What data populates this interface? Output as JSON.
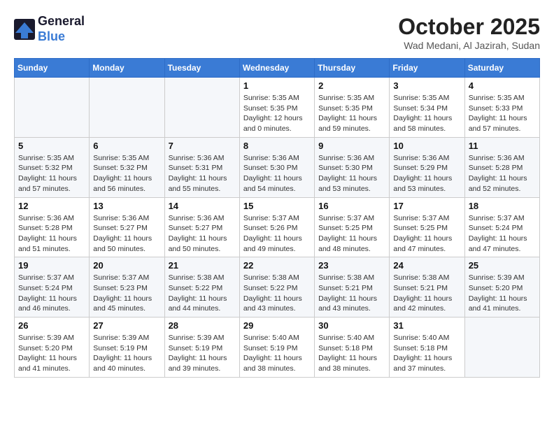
{
  "header": {
    "logo_line1": "General",
    "logo_line2": "Blue",
    "month_title": "October 2025",
    "subtitle": "Wad Medani, Al Jazirah, Sudan"
  },
  "weekdays": [
    "Sunday",
    "Monday",
    "Tuesday",
    "Wednesday",
    "Thursday",
    "Friday",
    "Saturday"
  ],
  "weeks": [
    [
      {
        "day": "",
        "info": ""
      },
      {
        "day": "",
        "info": ""
      },
      {
        "day": "",
        "info": ""
      },
      {
        "day": "1",
        "info": "Sunrise: 5:35 AM\nSunset: 5:35 PM\nDaylight: 12 hours and 0 minutes."
      },
      {
        "day": "2",
        "info": "Sunrise: 5:35 AM\nSunset: 5:35 PM\nDaylight: 11 hours and 59 minutes."
      },
      {
        "day": "3",
        "info": "Sunrise: 5:35 AM\nSunset: 5:34 PM\nDaylight: 11 hours and 58 minutes."
      },
      {
        "day": "4",
        "info": "Sunrise: 5:35 AM\nSunset: 5:33 PM\nDaylight: 11 hours and 57 minutes."
      }
    ],
    [
      {
        "day": "5",
        "info": "Sunrise: 5:35 AM\nSunset: 5:32 PM\nDaylight: 11 hours and 57 minutes."
      },
      {
        "day": "6",
        "info": "Sunrise: 5:35 AM\nSunset: 5:32 PM\nDaylight: 11 hours and 56 minutes."
      },
      {
        "day": "7",
        "info": "Sunrise: 5:36 AM\nSunset: 5:31 PM\nDaylight: 11 hours and 55 minutes."
      },
      {
        "day": "8",
        "info": "Sunrise: 5:36 AM\nSunset: 5:30 PM\nDaylight: 11 hours and 54 minutes."
      },
      {
        "day": "9",
        "info": "Sunrise: 5:36 AM\nSunset: 5:30 PM\nDaylight: 11 hours and 53 minutes."
      },
      {
        "day": "10",
        "info": "Sunrise: 5:36 AM\nSunset: 5:29 PM\nDaylight: 11 hours and 53 minutes."
      },
      {
        "day": "11",
        "info": "Sunrise: 5:36 AM\nSunset: 5:28 PM\nDaylight: 11 hours and 52 minutes."
      }
    ],
    [
      {
        "day": "12",
        "info": "Sunrise: 5:36 AM\nSunset: 5:28 PM\nDaylight: 11 hours and 51 minutes."
      },
      {
        "day": "13",
        "info": "Sunrise: 5:36 AM\nSunset: 5:27 PM\nDaylight: 11 hours and 50 minutes."
      },
      {
        "day": "14",
        "info": "Sunrise: 5:36 AM\nSunset: 5:27 PM\nDaylight: 11 hours and 50 minutes."
      },
      {
        "day": "15",
        "info": "Sunrise: 5:37 AM\nSunset: 5:26 PM\nDaylight: 11 hours and 49 minutes."
      },
      {
        "day": "16",
        "info": "Sunrise: 5:37 AM\nSunset: 5:25 PM\nDaylight: 11 hours and 48 minutes."
      },
      {
        "day": "17",
        "info": "Sunrise: 5:37 AM\nSunset: 5:25 PM\nDaylight: 11 hours and 47 minutes."
      },
      {
        "day": "18",
        "info": "Sunrise: 5:37 AM\nSunset: 5:24 PM\nDaylight: 11 hours and 47 minutes."
      }
    ],
    [
      {
        "day": "19",
        "info": "Sunrise: 5:37 AM\nSunset: 5:24 PM\nDaylight: 11 hours and 46 minutes."
      },
      {
        "day": "20",
        "info": "Sunrise: 5:37 AM\nSunset: 5:23 PM\nDaylight: 11 hours and 45 minutes."
      },
      {
        "day": "21",
        "info": "Sunrise: 5:38 AM\nSunset: 5:22 PM\nDaylight: 11 hours and 44 minutes."
      },
      {
        "day": "22",
        "info": "Sunrise: 5:38 AM\nSunset: 5:22 PM\nDaylight: 11 hours and 43 minutes."
      },
      {
        "day": "23",
        "info": "Sunrise: 5:38 AM\nSunset: 5:21 PM\nDaylight: 11 hours and 43 minutes."
      },
      {
        "day": "24",
        "info": "Sunrise: 5:38 AM\nSunset: 5:21 PM\nDaylight: 11 hours and 42 minutes."
      },
      {
        "day": "25",
        "info": "Sunrise: 5:39 AM\nSunset: 5:20 PM\nDaylight: 11 hours and 41 minutes."
      }
    ],
    [
      {
        "day": "26",
        "info": "Sunrise: 5:39 AM\nSunset: 5:20 PM\nDaylight: 11 hours and 41 minutes."
      },
      {
        "day": "27",
        "info": "Sunrise: 5:39 AM\nSunset: 5:19 PM\nDaylight: 11 hours and 40 minutes."
      },
      {
        "day": "28",
        "info": "Sunrise: 5:39 AM\nSunset: 5:19 PM\nDaylight: 11 hours and 39 minutes."
      },
      {
        "day": "29",
        "info": "Sunrise: 5:40 AM\nSunset: 5:19 PM\nDaylight: 11 hours and 38 minutes."
      },
      {
        "day": "30",
        "info": "Sunrise: 5:40 AM\nSunset: 5:18 PM\nDaylight: 11 hours and 38 minutes."
      },
      {
        "day": "31",
        "info": "Sunrise: 5:40 AM\nSunset: 5:18 PM\nDaylight: 11 hours and 37 minutes."
      },
      {
        "day": "",
        "info": ""
      }
    ]
  ]
}
